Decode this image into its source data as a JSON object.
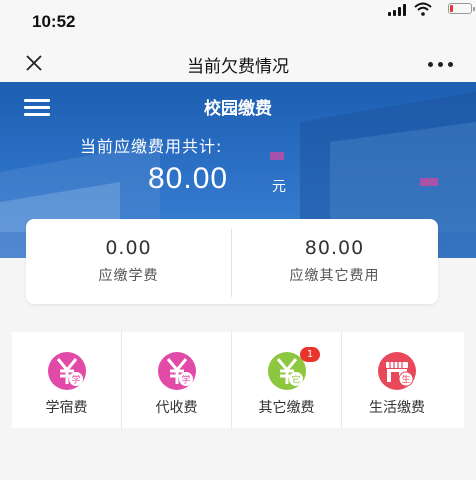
{
  "status_bar": {
    "time": "10:52"
  },
  "nav": {
    "title": "当前欠费情况"
  },
  "banner": {
    "title": "校园缴费",
    "total_label": "当前应缴费用共计:",
    "total_amount": "80.00",
    "unit": "元"
  },
  "summary": [
    {
      "value": "0.00",
      "label": "应缴学费"
    },
    {
      "value": "80.00",
      "label": "应缴其它费用"
    }
  ],
  "menu": [
    {
      "label": "学宿费",
      "icon_char": "学",
      "color": "#e24aa8"
    },
    {
      "label": "代收费",
      "icon_char": "学",
      "color": "#e24aa8"
    },
    {
      "label": "其它缴费",
      "icon_char": "它",
      "color": "#8dc63f",
      "badge": "1"
    },
    {
      "label": "生活缴费",
      "icon_char": "生",
      "color": "#e8485a"
    }
  ],
  "colors": {
    "banner": "#2a6fc4",
    "badge": "#e8342a"
  }
}
